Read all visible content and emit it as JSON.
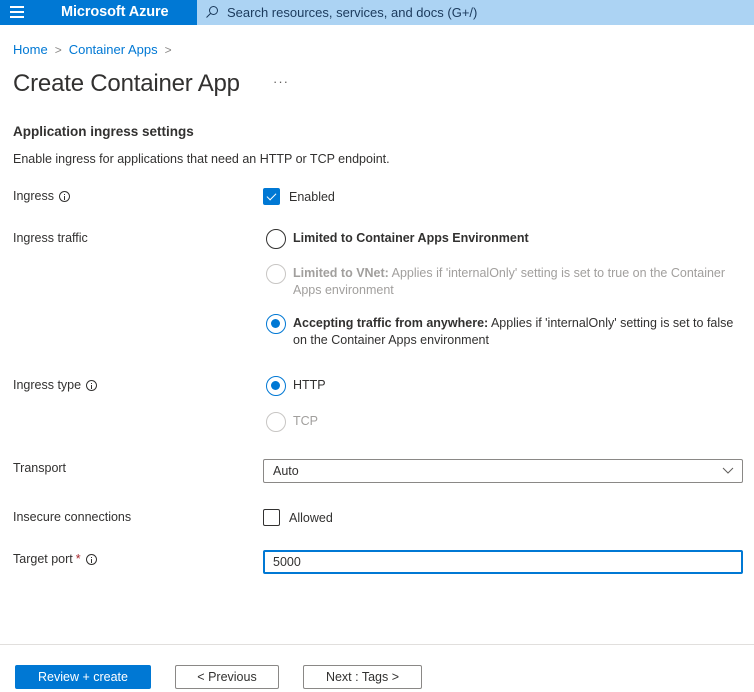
{
  "topbar": {
    "menu_icon": "hamburger-menu-icon",
    "brand": "Microsoft Azure",
    "search": {
      "icon": "search-icon",
      "placeholder": "Search resources, services, and docs (G+/)"
    },
    "colors": {
      "bar": "#0078d4",
      "search_bg": "#acd3f3"
    }
  },
  "breadcrumb": {
    "items": [
      {
        "label": "Home"
      },
      {
        "label": "Container Apps"
      }
    ],
    "separator": ">"
  },
  "page": {
    "title": "Create Container App",
    "more_label": "···"
  },
  "section": {
    "title": "Application ingress settings",
    "description": "Enable ingress for applications that need an HTTP or TCP endpoint."
  },
  "form": {
    "ingress": {
      "label": "Ingress",
      "checkbox_label": "Enabled",
      "checked": true
    },
    "ingress_traffic": {
      "label": "Ingress traffic",
      "options": [
        {
          "bold": "Limited to Container Apps Environment",
          "text": "",
          "selected": false,
          "disabled": false
        },
        {
          "bold": "Limited to VNet:",
          "text": " Applies if 'internalOnly' setting is set to true on the Container Apps environment",
          "selected": false,
          "disabled": true
        },
        {
          "bold": "Accepting traffic from anywhere:",
          "text": " Applies if 'internalOnly' setting is set to false on the Container Apps environment",
          "selected": true,
          "disabled": false
        }
      ]
    },
    "ingress_type": {
      "label": "Ingress type",
      "options": [
        {
          "label": "HTTP",
          "selected": true,
          "disabled": false
        },
        {
          "label": "TCP",
          "selected": false,
          "disabled": true
        }
      ]
    },
    "transport": {
      "label": "Transport",
      "value": "Auto"
    },
    "insecure_connections": {
      "label": "Insecure connections",
      "checkbox_label": "Allowed",
      "checked": false
    },
    "target_port": {
      "label": "Target port",
      "required_mark": "*",
      "value": "5000"
    }
  },
  "footer": {
    "review_create": "Review + create",
    "previous": "< Previous",
    "next": "Next : Tags >"
  },
  "colors": {
    "accent": "#0078d4",
    "text": "#323130",
    "disabled_text": "#a19f9d",
    "required": "#a4262c"
  }
}
